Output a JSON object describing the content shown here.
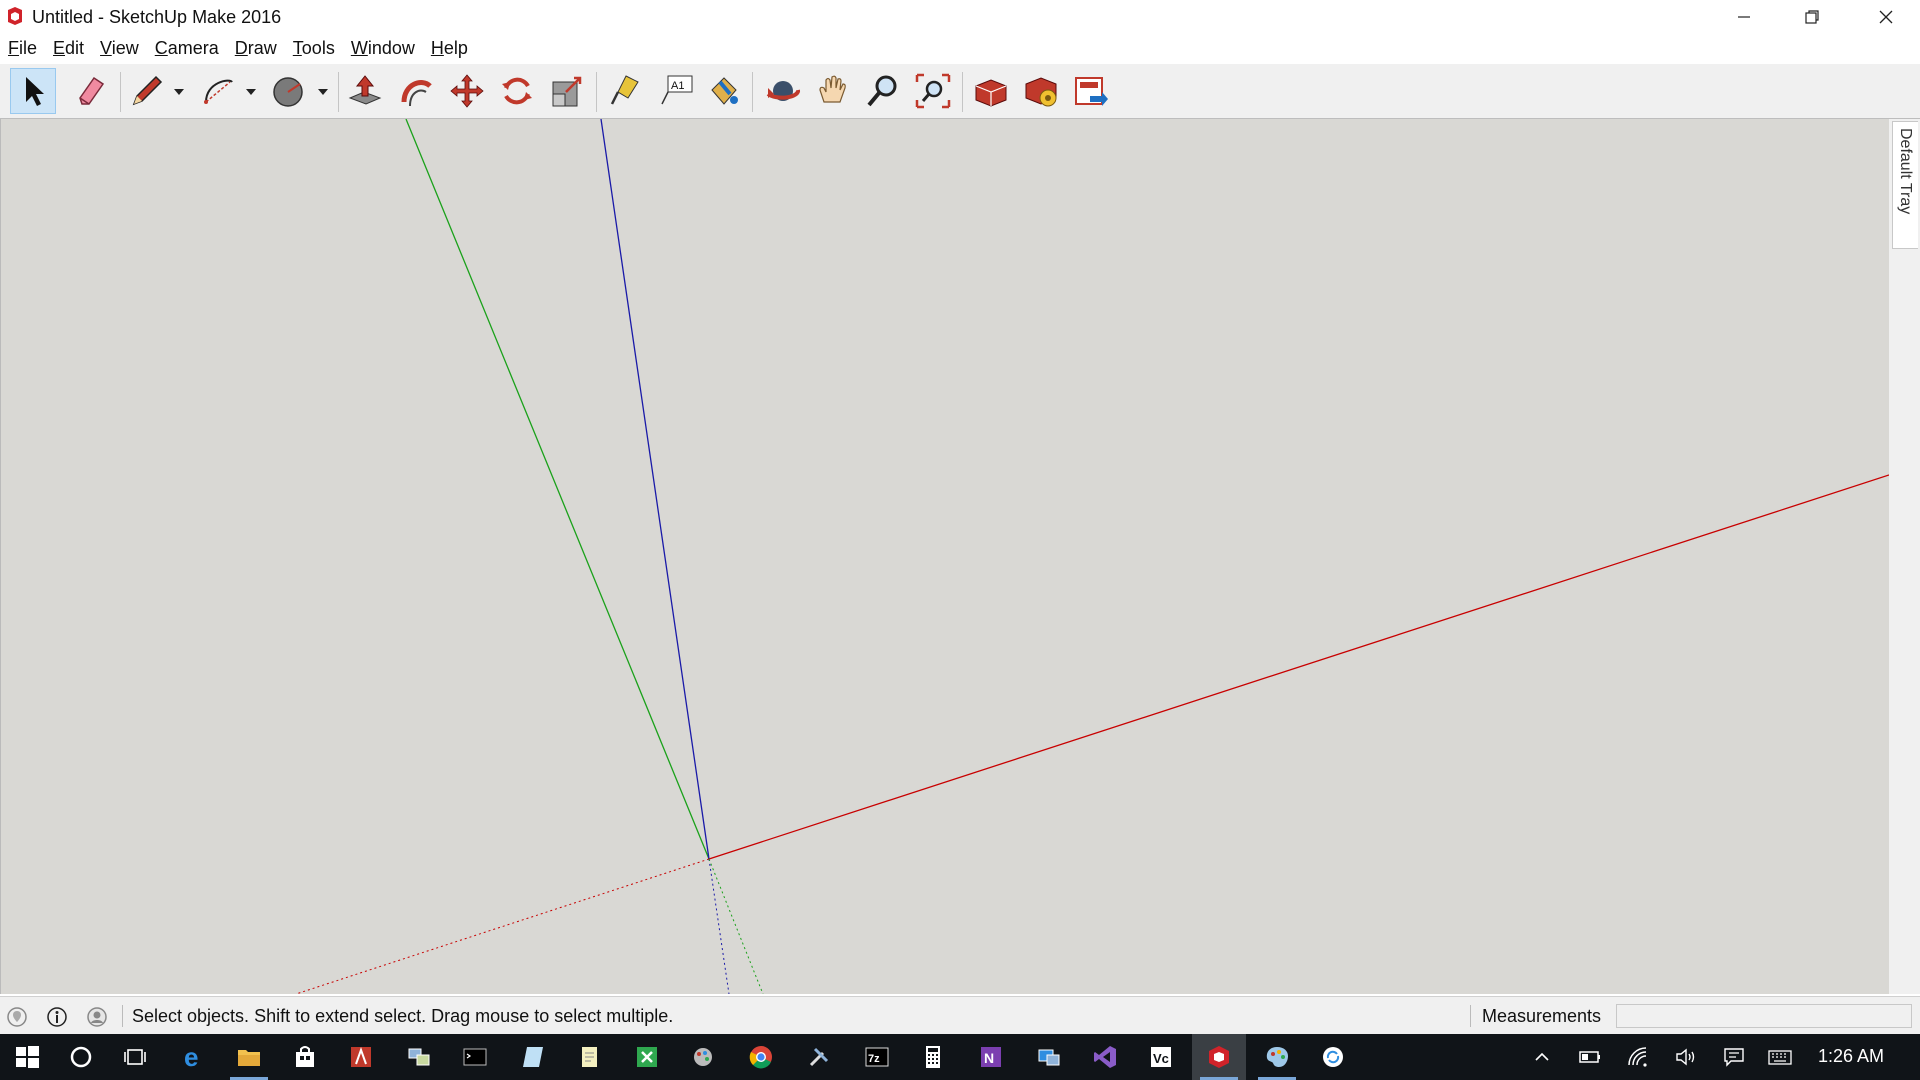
{
  "window": {
    "title": "Untitled - SketchUp Make 2016"
  },
  "menu": [
    "File",
    "Edit",
    "View",
    "Camera",
    "Draw",
    "Tools",
    "Window",
    "Help"
  ],
  "tray": {
    "label": "Default Tray"
  },
  "status": {
    "text": "Select objects. Shift to extend select. Drag mouse to select multiple."
  },
  "measurements": {
    "label": "Measurements",
    "value": ""
  },
  "taskbar": {
    "clock": "1:26 AM"
  },
  "colors": {
    "canvas_bg": "#d9d8d4",
    "axis_red": "#c80000",
    "axis_green": "#1aa11a",
    "axis_blue": "#1a1aa8",
    "taskbar_bg": "#101418",
    "selected_tool": "#cce4f7"
  }
}
